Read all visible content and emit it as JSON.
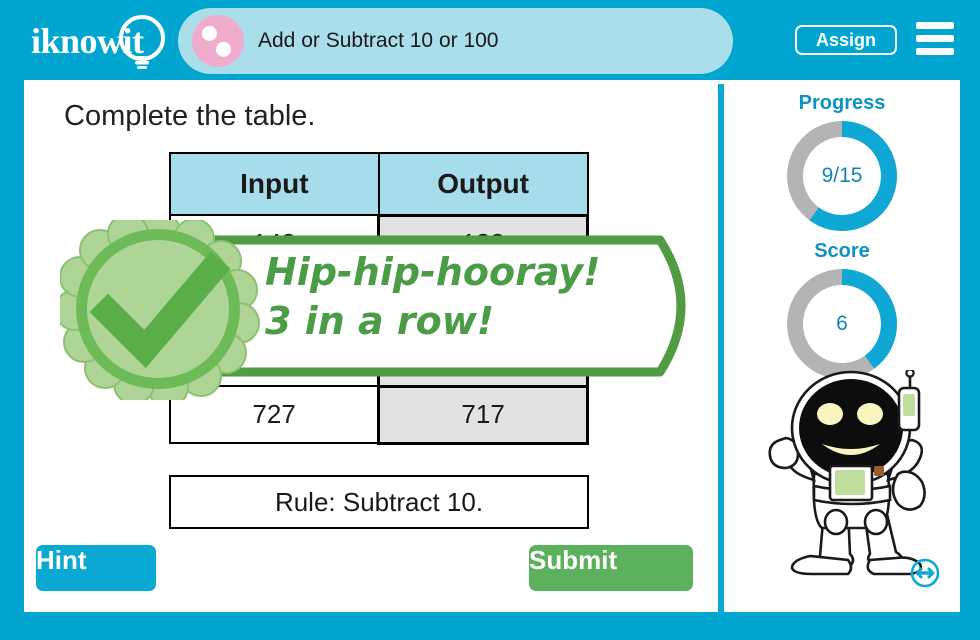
{
  "header": {
    "logo_text": "iknowit",
    "logo_icon": "lightbulb-icon",
    "title": "Add or Subtract 10 or 100",
    "topic_icon": "pink-circle-dots-icon",
    "assign_label": "Assign",
    "menu_icon": "hamburger-menu-icon"
  },
  "question": {
    "heading": "Complete the table.",
    "table": {
      "headers": [
        "Input",
        "Output"
      ],
      "rows": [
        {
          "input": "148",
          "output": "138",
          "is_answer": true
        },
        {
          "input": "",
          "output": "",
          "is_answer": true
        },
        {
          "input": "",
          "output": "",
          "is_answer": true
        },
        {
          "input": "727",
          "output": "717",
          "is_answer": true
        }
      ]
    },
    "rule": "Rule: Subtract 10."
  },
  "actions": {
    "hint_label": "Hint",
    "submit_label": "Submit"
  },
  "feedback": {
    "line1": "Hip-hip-hooray!",
    "line2": "3 in a row!",
    "badge_icon": "green-checkmark-rosette-icon",
    "accent_color": "#4a9c45"
  },
  "sidebar": {
    "progress": {
      "label": "Progress",
      "value": "9/15",
      "percent": 60
    },
    "score": {
      "label": "Score",
      "value": "6",
      "percent": 40
    },
    "mascot_icon": "astronaut-robot-mascot",
    "resize_icon": "resize-horizontal-icon"
  },
  "colors": {
    "brand_blue": "#00a5d0",
    "title_bar_blue": "#aadeeb",
    "table_header_blue": "#a7dceb",
    "answer_cell_gray": "#e2e2e2",
    "submit_green": "#5cb15c",
    "feedback_green": "#4a9c45",
    "topic_pink": "#efaccd"
  }
}
